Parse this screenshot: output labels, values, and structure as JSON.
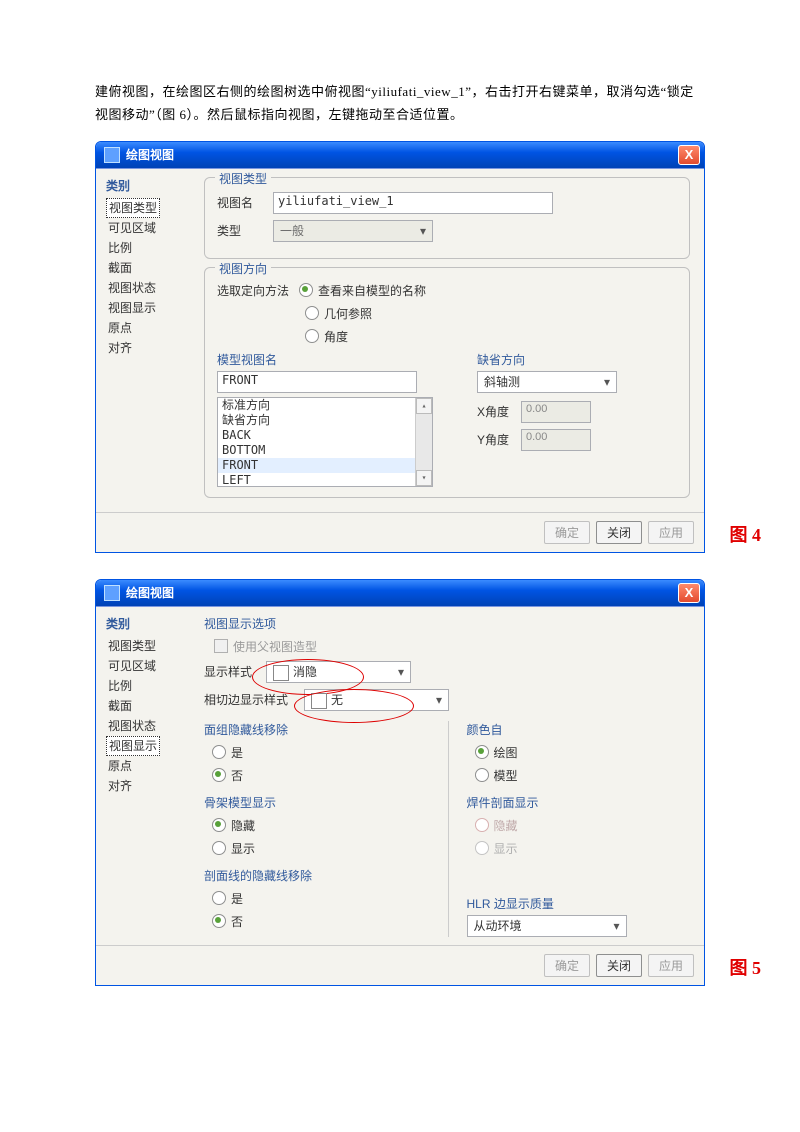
{
  "body_text": "建俯视图，在绘图区右侧的绘图树选中俯视图“yiliufati_view_1”，右击打开右键菜单，取消勾选“锁定视图移动”（图 6）。然后鼠标指向视图，左键拖动至合适位置。",
  "dialog1": {
    "title": "绘图视图",
    "sidebar_label": "类别",
    "sidebar_items": [
      "视图类型",
      "可见区域",
      "比例",
      "截面",
      "视图状态",
      "视图显示",
      "原点",
      "对齐"
    ],
    "group_type": "视图类型",
    "viewname_label": "视图名",
    "viewname_value": "yiliufati_view_1",
    "type_label": "类型",
    "type_value": "一般",
    "group_dir": "视图方向",
    "orient_label": "选取定向方法",
    "orient_opts": [
      "查看来自模型的名称",
      "几何参照",
      "角度"
    ],
    "model_view_label": "模型视图名",
    "model_view_value": "FRONT",
    "view_list": [
      "标准方向",
      "缺省方向",
      "BACK",
      "BOTTOM",
      "FRONT",
      "LEFT"
    ],
    "default_dir_label": "缺省方向",
    "default_dir_value": "斜轴测",
    "xangle_label": "X角度",
    "xangle_value": "0.00",
    "yangle_label": "Y角度",
    "yangle_value": "0.00"
  },
  "dialog2": {
    "title": "绘图视图",
    "sidebar_label": "类别",
    "sidebar_items": [
      "视图类型",
      "可见区域",
      "比例",
      "截面",
      "视图状态",
      "视图显示",
      "原点",
      "对齐"
    ],
    "group_disp": "视图显示选项",
    "use_parent": "使用父视图造型",
    "style_label": "显示样式",
    "style_value": "消隐",
    "tan_label": "相切边显示样式",
    "tan_value": "无",
    "face_label": "面组隐藏线移除",
    "opts_yesno": [
      "是",
      "否"
    ],
    "color_label": "颜色自",
    "color_opts": [
      "绘图",
      "模型"
    ],
    "skel_label": "骨架模型显示",
    "skel_opts": [
      "隐藏",
      "显示"
    ],
    "weld_label": "焊件剖面显示",
    "weld_opts": [
      "隐藏",
      "显示"
    ],
    "section_label": "剖面线的隐藏线移除",
    "hlr_label": "HLR 边显示质量",
    "hlr_value": "从动环境"
  },
  "buttons": {
    "ok": "确定",
    "close": "关闭",
    "apply": "应用"
  },
  "fig4": "图 4",
  "fig5": "图 5",
  "arrow_down": "▾",
  "arrow_up": "▴",
  "close_x": "X"
}
